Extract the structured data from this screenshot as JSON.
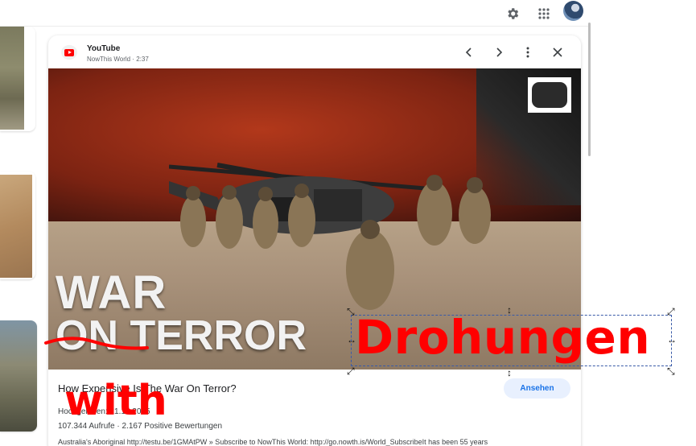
{
  "topbar": {
    "settings_icon": "gear-icon",
    "apps_icon": "grid-apps-icon",
    "avatar": "user-avatar"
  },
  "card": {
    "source_name": "YouTube",
    "source_meta": "NowThis World · 2:37",
    "prev_icon": "chevron-left-icon",
    "next_icon": "chevron-right-icon",
    "more_icon": "more-vert-icon",
    "close_icon": "close-icon",
    "thumbnail_text_line1": "WAR",
    "thumbnail_text_line2": "ON TERROR",
    "title": "How Expensive Is The War On Terror?",
    "published": "Hochgeladen: 21.10.2015",
    "stats": "107.344 Aufrufe · 2.167 Positive Bewertungen",
    "description": "Australia's Aboriginal http://testu.be/1GMAtPW » Subscribe to NowThis World: http://go.nowth.is/World_SubscribeIt has been 55 years",
    "view_button": "Ansehen"
  },
  "overlay": {
    "drohungen": "Drohungen",
    "with": "with"
  },
  "colors": {
    "accent_red": "#ff0000",
    "button_bg": "#e8f0fe",
    "button_text": "#1a73e8"
  }
}
